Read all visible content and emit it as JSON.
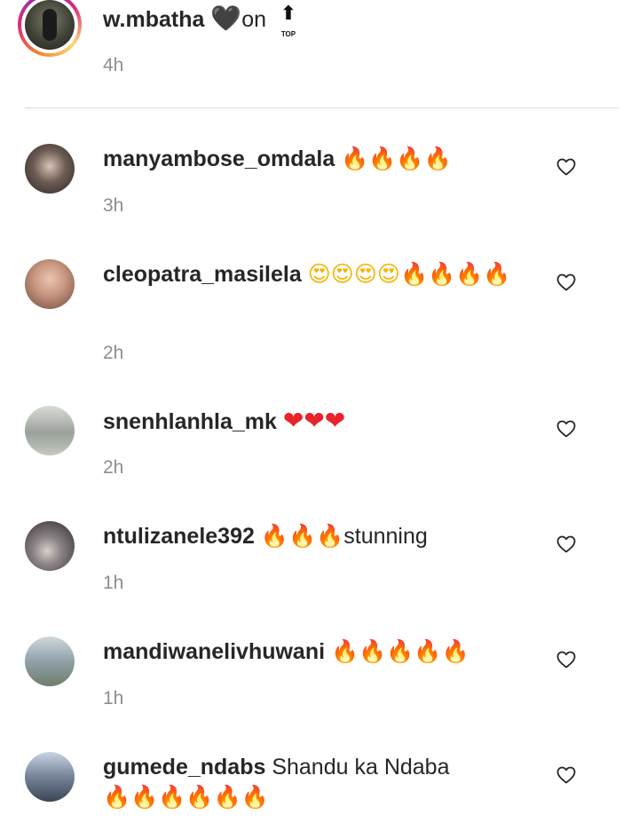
{
  "post": {
    "username": "w.mbatha",
    "caption_emoji_heart": "🖤",
    "caption_text": "on",
    "caption_emoji_top_arrow": "⬆",
    "caption_emoji_top_label": "TOP",
    "time": "4h"
  },
  "comments": [
    {
      "username": "manyambose_omdala",
      "text_before": "",
      "emojis": "🔥🔥🔥🔥",
      "text_after": "",
      "time": "3h",
      "avatar_color": "#6b5a52"
    },
    {
      "username": "cleopatra_masilela",
      "text_before": "",
      "emojis_heart_eyes": "😍😍😍😍",
      "emojis": "🔥🔥🔥🔥",
      "text_after": "",
      "time": "2h",
      "avatar_color": "#c99782"
    },
    {
      "username": "snenhlanhla_mk",
      "text_before": "",
      "emojis_hearts": "❤❤❤",
      "text_after": "",
      "time": "2h",
      "avatar_color": "#9aa09a"
    },
    {
      "username": "ntulizanele392",
      "text_before": "",
      "emojis": "🔥🔥🔥",
      "text_after": "stunning",
      "time": "1h",
      "avatar_color": "#514b4d"
    },
    {
      "username": "mandiwanelivhuwani",
      "text_before": "",
      "emojis": "🔥🔥🔥🔥🔥",
      "text_after": "",
      "time": "1h",
      "avatar_color": "#8fa0a8"
    },
    {
      "username": "gumede_ndabs",
      "text_before": "Shandu ka Ndaba",
      "emojis": "🔥🔥🔥🔥🔥🔥",
      "text_after": "",
      "time": "",
      "avatar_color": "#7d8ba0"
    }
  ],
  "icons": {
    "like": "heart-outline-icon",
    "fire": "fire-emoji",
    "heart_eyes": "smiling-face-with-heart-eyes-emoji",
    "red_heart": "red-heart-emoji"
  },
  "colors": {
    "text_primary": "#262626",
    "text_secondary": "#8e8e8e",
    "divider": "#dbdbdb",
    "story_ring_start": "#f58529",
    "story_ring_mid": "#dd2a7b"
  }
}
